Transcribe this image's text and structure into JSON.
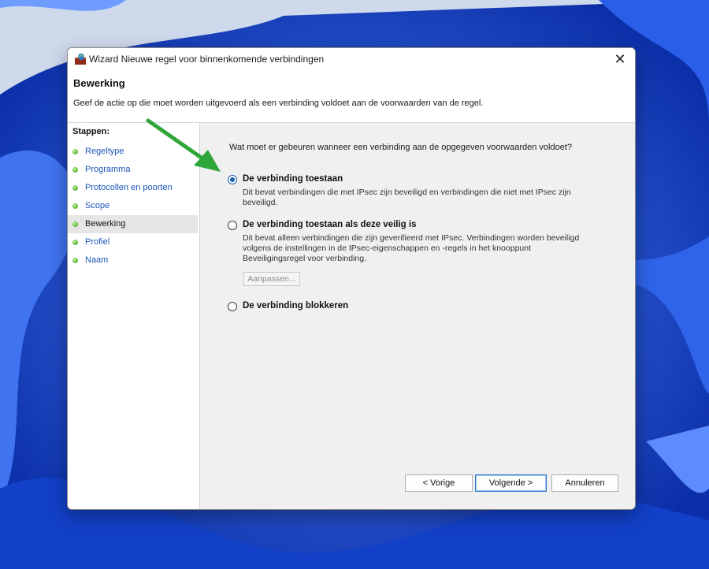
{
  "window": {
    "title": "Wizard Nieuwe regel voor binnenkomende verbindingen",
    "close_glyph": "✕"
  },
  "header": {
    "title": "Bewerking",
    "description": "Geef de actie op die moet worden uitgevoerd als een verbinding voldoet aan de voorwaarden van de regel."
  },
  "sidebar": {
    "title": "Stappen:",
    "items": [
      {
        "label": "Regeltype"
      },
      {
        "label": "Programma"
      },
      {
        "label": "Protocollen en poorten"
      },
      {
        "label": "Scope"
      },
      {
        "label": "Bewerking",
        "active": true
      },
      {
        "label": "Profiel"
      },
      {
        "label": "Naam"
      }
    ]
  },
  "main": {
    "question": "Wat moet er gebeuren wanneer een verbinding aan de opgegeven voorwaarden voldoet?",
    "options": [
      {
        "label": "De verbinding toestaan",
        "description": "Dit bevat verbindingen die met IPsec zijn beveiligd en verbindingen die niet met IPsec zijn beveiligd.",
        "selected": true
      },
      {
        "label": "De verbinding toestaan als deze veilig is",
        "description": "Dit bevat alleen verbindingen die zijn geverifieerd met IPsec. Verbindingen worden beveiligd volgens de instellingen in de IPsec-eigenschappen en -regels in het knooppunt Beveiligingsregel voor verbinding.",
        "selected": false
      },
      {
        "label": "De verbinding blokkeren",
        "description": "",
        "selected": false
      }
    ],
    "customize_button": "Aanpassen..."
  },
  "footer": {
    "back": "< Vorige",
    "next": "Volgende >",
    "cancel": "Annuleren"
  },
  "colors": {
    "accent": "#1a5fb4",
    "link": "#1a56b8",
    "annotation_arrow": "#2fa63a"
  }
}
